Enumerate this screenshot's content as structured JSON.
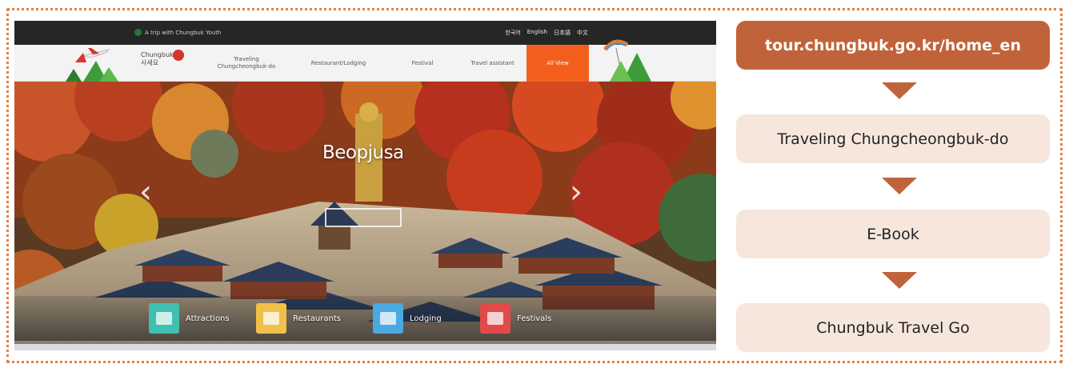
{
  "site": {
    "topbar": {
      "brand": "A trip with Chungbuk Youth",
      "languages": [
        "한국어",
        "English",
        "日本語",
        "中文"
      ]
    },
    "logo_text": "Chungbuk 사세요",
    "nav": [
      {
        "label": "Traveling Chungcheongbuk-do"
      },
      {
        "label": "Restaurant/Lodging"
      },
      {
        "label": "Festival"
      },
      {
        "label": "Travel assistant"
      },
      {
        "label": "All View"
      }
    ],
    "hero_title": "Beopjusa",
    "quick_links": [
      {
        "label": "Attractions",
        "icon": "attractions-icon",
        "color": "#3fbfb0"
      },
      {
        "label": "Restaurants",
        "icon": "restaurants-icon",
        "color": "#f0c04a"
      },
      {
        "label": "Lodging",
        "icon": "lodging-icon",
        "color": "#4aa9e0"
      },
      {
        "label": "Festivals",
        "icon": "festivals-icon",
        "color": "#e04a4a"
      }
    ]
  },
  "flow": {
    "steps": [
      {
        "label": "tour.chungbuk.go.kr/home_en",
        "style": "primary"
      },
      {
        "label": "Traveling Chungcheongbuk-do",
        "style": "secondary"
      },
      {
        "label": "E-Book",
        "style": "secondary"
      },
      {
        "label": "Chungbuk Travel Go",
        "style": "secondary"
      }
    ]
  },
  "colors": {
    "frame": "#e0804a",
    "primary": "#c1633a",
    "secondary": "#f6e6dc",
    "nav_active": "#f25f1c"
  }
}
